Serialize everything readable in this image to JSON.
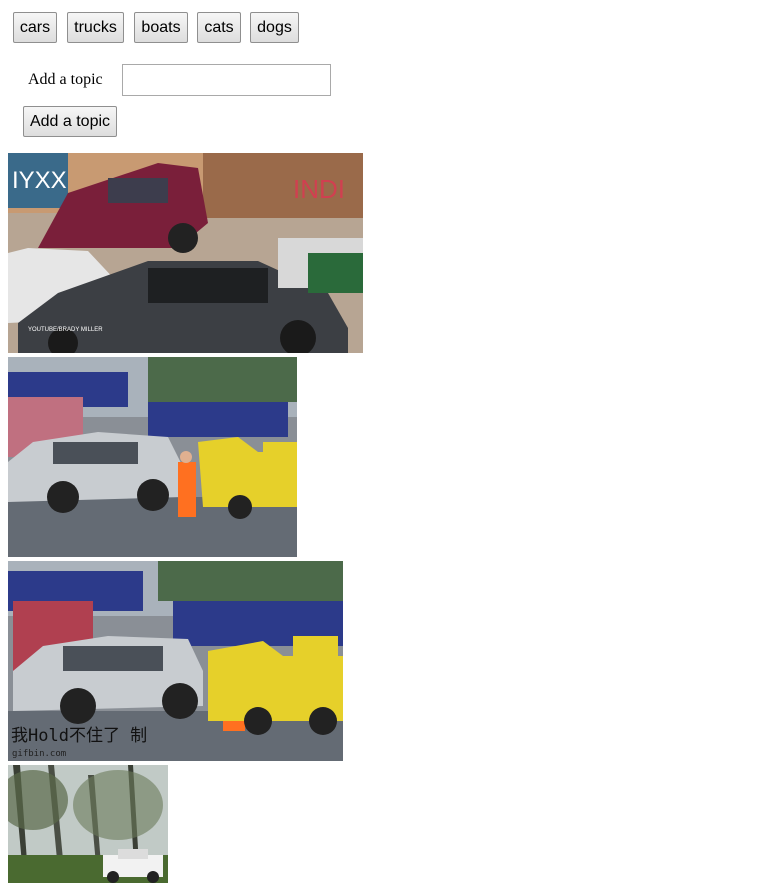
{
  "topics": [
    "cars",
    "trucks",
    "boats",
    "cats",
    "dogs"
  ],
  "form": {
    "label": "Add a topic",
    "input_value": "",
    "submit_label": "Add a topic"
  },
  "gifs": [
    {
      "watermark": "YOUTUBE/BRADY MILLER"
    },
    {
      "watermark": ""
    },
    {
      "watermark": "我Hold不住了 制",
      "credit": "gifbin.com"
    },
    {
      "watermark": ""
    }
  ]
}
